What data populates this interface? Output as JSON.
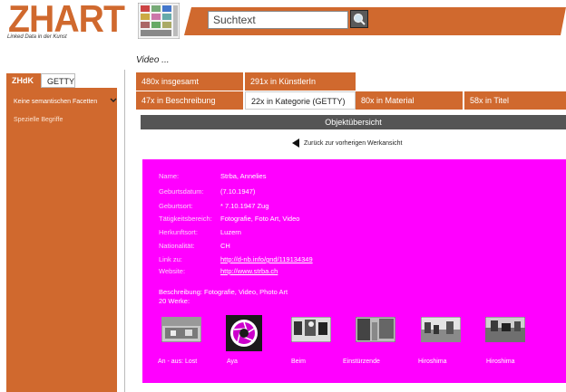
{
  "header": {
    "logo_text": "ZHART",
    "logo_tagline": "Linked Data in der Kunst",
    "search_placeholder": "Suchtext"
  },
  "sidebar": {
    "tabs": [
      {
        "label": "ZHdK"
      },
      {
        "label": "GETTY"
      }
    ],
    "items": [
      {
        "label": "Keine semantischen Facetten"
      },
      {
        "label": "Spezielle Begriffe"
      }
    ]
  },
  "main": {
    "title": "Video ...",
    "counts": [
      {
        "label": "480x insgesamt"
      },
      {
        "label": "291x in KünstlerIn"
      },
      {
        "label": "47x in Beschreibung"
      },
      {
        "label": "22x in Kategorie (GETTY)"
      },
      {
        "label": "80x in Material"
      },
      {
        "label": "58x in Titel"
      }
    ],
    "overview_title": "Objektübersicht",
    "back_label": "Zurück zur vorherigen Werkansicht"
  },
  "info": {
    "fields": [
      {
        "label": "Name:",
        "value": "Strba, Annelies"
      },
      {
        "label": "Geburtsdatum:",
        "value": "(7.10.1947)"
      },
      {
        "label": "Geburtsort:",
        "value": "* 7.10.1947 Zug"
      },
      {
        "label": "Tätigkeitsbereich:",
        "value": "Fotografie, Foto Art, Video"
      },
      {
        "label": "Herkunftsort:",
        "value": "Luzern"
      },
      {
        "label": "Nationalität:",
        "value": "CH"
      },
      {
        "label": "Link zu:",
        "value": "http://d-nb.info/gnd/119134349"
      },
      {
        "label": "Website:",
        "value": "http://www.strba.ch"
      }
    ],
    "description": "Beschreibung:  Fotografie, Video, Photo Art",
    "works_count": "20 Werke:",
    "works": [
      {
        "caption": "An - aus: Lost"
      },
      {
        "caption": "Aya"
      },
      {
        "caption": "Beim"
      },
      {
        "caption": "Einstürzende"
      },
      {
        "caption": "Hiroshima"
      },
      {
        "caption": "Hiroshima"
      }
    ]
  },
  "colors": {
    "accent_orange": "#d0692e",
    "magenta": "#ff00ff",
    "dark_bar": "#555555"
  }
}
